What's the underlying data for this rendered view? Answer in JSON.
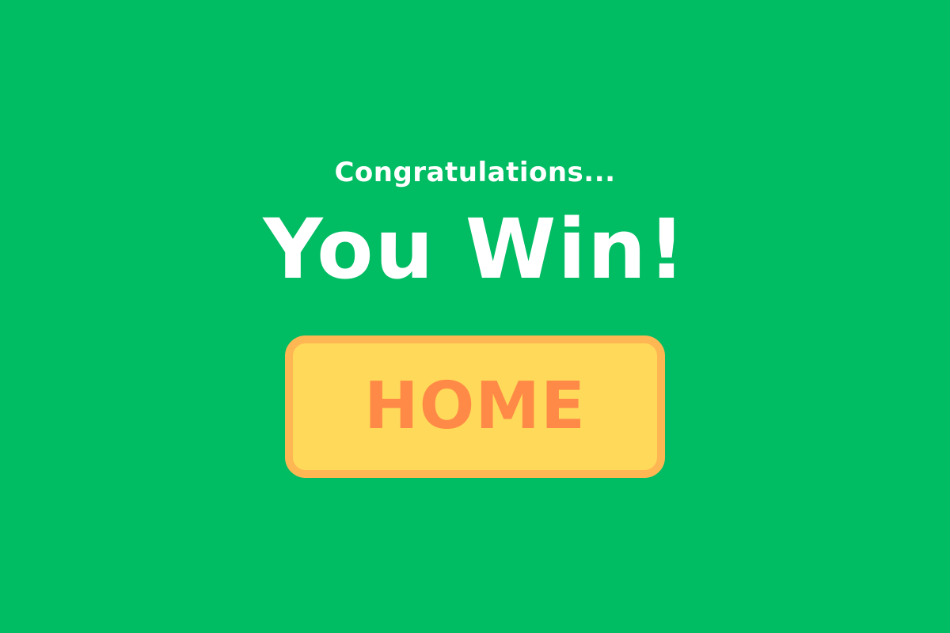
{
  "screen": {
    "subtitle": "Congratulations...",
    "title": "You Win!",
    "home_button_label": "HOME"
  },
  "colors": {
    "background": "#00BC62",
    "text": "#FFFFFF",
    "button_fill": "#FFD95A",
    "button_border": "#FFB754",
    "button_text": "#FF8A47"
  }
}
